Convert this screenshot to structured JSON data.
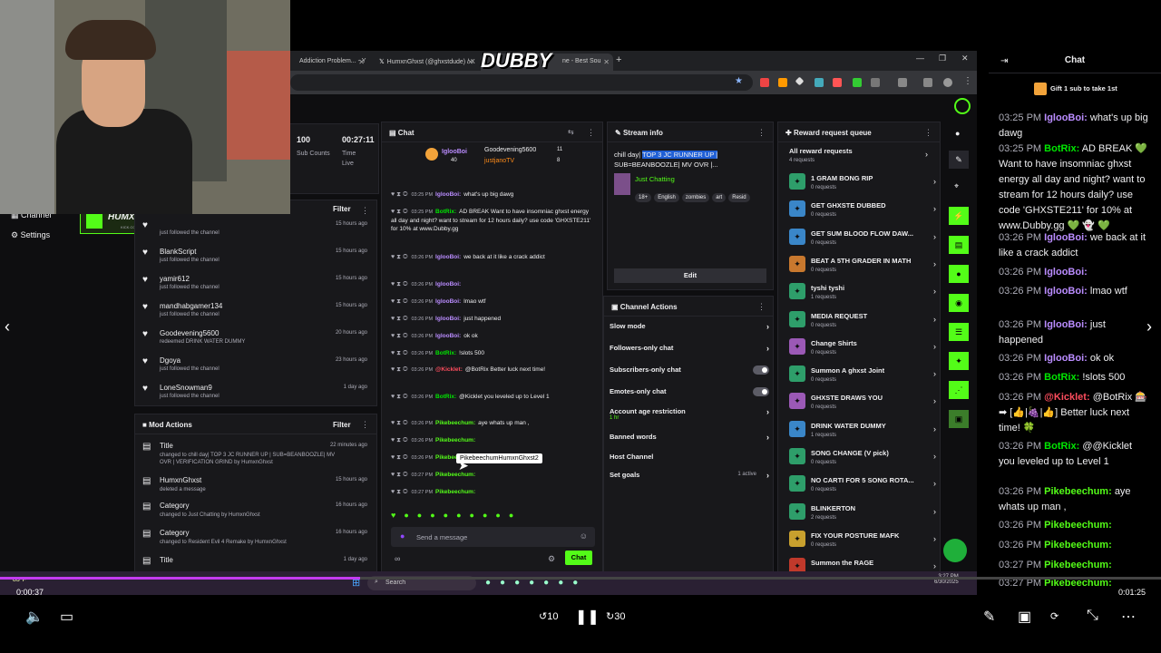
{
  "brand": "DUBBY",
  "browser": {
    "tabs": [
      "Addiction Problem... - Y",
      "HumxnGhxst (@ghxstdude) / X",
      "ne - Best Sou"
    ]
  },
  "dashboard": {
    "sidebar": {
      "channel": "Channel",
      "settings": "Settings"
    },
    "stats": [
      {
        "value": "100",
        "label": "Sub Counts"
      },
      {
        "value": "00:27:11",
        "label": "Time Live"
      }
    ],
    "overlay_logo": "HUMXNGHXST",
    "overlay_url": "KICK.COM/HUMXNGHXST",
    "activity": {
      "filter": "Filter",
      "items": [
        {
          "name": "",
          "sub": "just followed the channel",
          "time": "15 hours ago"
        },
        {
          "name": "BlankScript",
          "sub": "just followed the channel",
          "time": "15 hours ago"
        },
        {
          "name": "yamir612",
          "sub": "just followed the channel",
          "time": "15 hours ago"
        },
        {
          "name": "mandhabgamer134",
          "sub": "just followed the channel",
          "time": "15 hours ago"
        },
        {
          "name": "Goodevening5600",
          "sub": "redeemed DRINK WATER DUMMY",
          "time": "20 hours ago"
        },
        {
          "name": "Dgoya",
          "sub": "just followed the channel",
          "time": "23 hours ago"
        },
        {
          "name": "LoneSnowman9",
          "sub": "just followed the channel",
          "time": "1 day ago"
        }
      ]
    },
    "mod_actions": {
      "title": "Mod Actions",
      "filter": "Filter",
      "items": [
        {
          "name": "Title",
          "text": "changed to chill day| TOP 3 JC RUNNER UP | SUB=BEANBOOZLE| MV OVR | VERIFICATION GRIND by HumxnGhxst",
          "time": "22 minutes ago"
        },
        {
          "name": "HumxnGhxst",
          "text": "deleted a message",
          "time": "15 hours ago"
        },
        {
          "name": "Category",
          "text": "changed to Just Chatting by HumxnGhxst",
          "time": "16 hours ago"
        },
        {
          "name": "Category",
          "text": "changed to Resident Evil 4 Remake by HumxnGhxst",
          "time": "16 hours ago"
        },
        {
          "name": "Title",
          "text": "",
          "time": "1 day ago"
        }
      ]
    },
    "chat": {
      "title": "Chat",
      "leaders": [
        {
          "name": "IglooBoi",
          "count": "40"
        },
        {
          "name": "Goodevening5600",
          "count": "11"
        },
        {
          "name": "justjanoTV",
          "count": "8"
        }
      ],
      "lines": [
        {
          "time": "03:25 PM",
          "user": "IglooBoi:",
          "text": "what's up big dawg"
        },
        {
          "time": "03:25 PM",
          "user": "BotRix:",
          "text": "AD BREAK Want to have insomniac ghxst energy all day and night? want to stream for 12 hours daily? use code 'GHXSTE211' for 10% at www.Dubby.gg"
        },
        {
          "time": "03:26 PM",
          "user": "IglooBoi:",
          "text": "we back at it like a crack addict"
        },
        {
          "time": "03:26 PM",
          "user": "IglooBoi:",
          "text": ""
        },
        {
          "time": "03:26 PM",
          "user": "IglooBoi:",
          "text": "lmao wtf"
        },
        {
          "time": "03:26 PM",
          "user": "IglooBoi:",
          "text": "just happened"
        },
        {
          "time": "03:26 PM",
          "user": "IglooBoi:",
          "text": "ok ok"
        },
        {
          "time": "03:26 PM",
          "user": "BotRix:",
          "text": "!slots 500"
        },
        {
          "time": "03:26 PM",
          "user": "@Kicklet:",
          "text": "@BotRix Better luck next time!"
        },
        {
          "time": "03:26 PM",
          "user": "BotRix:",
          "text": "@Kicklet you leveled up to Level 1"
        },
        {
          "time": "03:26 PM",
          "user": "Pikebeechum:",
          "text": "aye whats up man ,"
        },
        {
          "time": "03:26 PM",
          "user": "Pikebeechum:",
          "text": ""
        },
        {
          "time": "03:26 PM",
          "user": "Pikebeechum:",
          "text": ""
        },
        {
          "time": "03:27 PM",
          "user": "Pikebeechum:",
          "text": ""
        },
        {
          "time": "03:27 PM",
          "user": "Pikebeechum:",
          "text": ""
        }
      ],
      "tooltip": "PikebeechumHumxnGhxst2",
      "placeholder": "Send a message",
      "send": "Chat"
    },
    "stream_info": {
      "title": "Stream info",
      "stream_title_plain": "chill day|",
      "stream_title_highlight": "TOP 3 JC RUNNER UP |",
      "stream_title_rest": "SUB=BEANBOOZLE| MV OVR |...",
      "category": "Just Chatting",
      "tags": [
        "18+",
        "English",
        "zombies",
        "art",
        "Resid"
      ],
      "edit": "Edit"
    },
    "channel_actions": {
      "title": "Channel Actions",
      "items": [
        {
          "label": "Slow mode",
          "kind": "chevron",
          "sub": ""
        },
        {
          "label": "Followers-only chat",
          "kind": "chevron",
          "sub": ""
        },
        {
          "label": "Subscribers-only chat",
          "kind": "toggle",
          "sub": ""
        },
        {
          "label": "Emotes-only chat",
          "kind": "toggle",
          "sub": ""
        },
        {
          "label": "Account age restriction",
          "kind": "chevron",
          "sub": "1 hr"
        },
        {
          "label": "Banned words",
          "kind": "chevron",
          "sub": ""
        },
        {
          "label": "Host Channel",
          "kind": "none",
          "sub": ""
        },
        {
          "label": "Set goals",
          "kind": "chevron",
          "sub": "1 active"
        }
      ]
    },
    "reward_queue": {
      "title": "Reward request queue",
      "all": "All reward requests",
      "all_count": "4 requests",
      "items": [
        {
          "title": "1 GRAM BONG RIP",
          "count": "0 requests"
        },
        {
          "title": "GET GHXSTE DUBBED",
          "count": "0 requests"
        },
        {
          "title": "GET SUM BLOOD FLOW DAW...",
          "count": "0 requests"
        },
        {
          "title": "BEAT A 5TH GRADER IN MATH",
          "count": "0 requests"
        },
        {
          "title": "tyshi tyshi",
          "count": "1 requests"
        },
        {
          "title": "MEDIA REQUEST",
          "count": "0 requests"
        },
        {
          "title": "Change Shirts",
          "count": "0 requests"
        },
        {
          "title": "Summon A ghxst Joint",
          "count": "0 requests"
        },
        {
          "title": "GHXSTE DRAWS YOU",
          "count": "0 requests"
        },
        {
          "title": "DRINK WATER DUMMY",
          "count": "1 requests"
        },
        {
          "title": "SONG CHANGE (V pick)",
          "count": "0 requests"
        },
        {
          "title": "NO CARTI FOR 5 SONG ROTA...",
          "count": "0 requests"
        },
        {
          "title": "BLINKERTON",
          "count": "2 requests"
        },
        {
          "title": "FIX YOUR POSTURE MAFK",
          "count": "0 requests"
        },
        {
          "title": "Summon the RAGE",
          "count": ""
        }
      ]
    },
    "taskbar": {
      "weather": "83°F",
      "search": "Search",
      "time": "3:27 PM",
      "date": "6/30/2025"
    }
  },
  "side_chat": {
    "title": "Chat",
    "gift": "Gift 1 sub to take 1st",
    "messages": [
      {
        "time": "03:25 PM",
        "user": "IglooBoi:",
        "class": "u-igloo",
        "text": "what's up big dawg"
      },
      {
        "time": "03:25 PM",
        "user": "BotRix:",
        "class": "u-botrix",
        "text": "AD BREAK 💚 Want to have insomniac ghxst energy all day and night? want to stream for 12 hours daily? use code 'GHXSTE211' for 10% at www.Dubby.gg 💚 👻 💚"
      },
      {
        "time": "03:26 PM",
        "user": "IglooBoi:",
        "class": "u-igloo",
        "text": "we back at it like a crack addict"
      },
      {
        "time": "03:26 PM",
        "user": "IglooBoi:",
        "class": "u-igloo",
        "text": ""
      },
      {
        "time": "03:26 PM",
        "user": "IglooBoi:",
        "class": "u-igloo",
        "text": "lmao wtf"
      },
      {
        "time": "03:26 PM",
        "user": "IglooBoi:",
        "class": "u-igloo",
        "text": "just happened"
      },
      {
        "time": "03:26 PM",
        "user": "IglooBoi:",
        "class": "u-igloo",
        "text": "ok ok"
      },
      {
        "time": "03:26 PM",
        "user": "BotRix:",
        "class": "u-botrix",
        "text": "!slots 500"
      },
      {
        "time": "03:26 PM",
        "user": "@Kicklet:",
        "class": "u-kick",
        "text": "@BotRix 🎰 ➡ [👍|🍇|👍] Better luck next time! 🍀"
      },
      {
        "time": "03:26 PM",
        "user": "BotRix:",
        "class": "u-botrix",
        "text": "@@Kicklet you leveled up to Level 1"
      },
      {
        "time": "03:26 PM",
        "user": "Pikebeechum:",
        "class": "u-pike",
        "text": "aye whats up man ,"
      },
      {
        "time": "03:26 PM",
        "user": "Pikebeechum:",
        "class": "u-pike",
        "text": ""
      },
      {
        "time": "03:26 PM",
        "user": "Pikebeechum:",
        "class": "u-pike",
        "text": ""
      },
      {
        "time": "03:27 PM",
        "user": "Pikebeechum:",
        "class": "u-pike",
        "text": ""
      },
      {
        "time": "03:27 PM",
        "user": "Pikebeechum:",
        "class": "u-pike",
        "text": ""
      }
    ]
  },
  "player": {
    "elapsed": "0:00:37",
    "remaining": "0:01:25",
    "progress": 0.31,
    "skip_back": "10",
    "skip_forward": "30"
  },
  "colors": {
    "accent": "#53fc18",
    "purple": "#ba8cff",
    "bg": "#0e0e10",
    "panel": "#18181b"
  }
}
